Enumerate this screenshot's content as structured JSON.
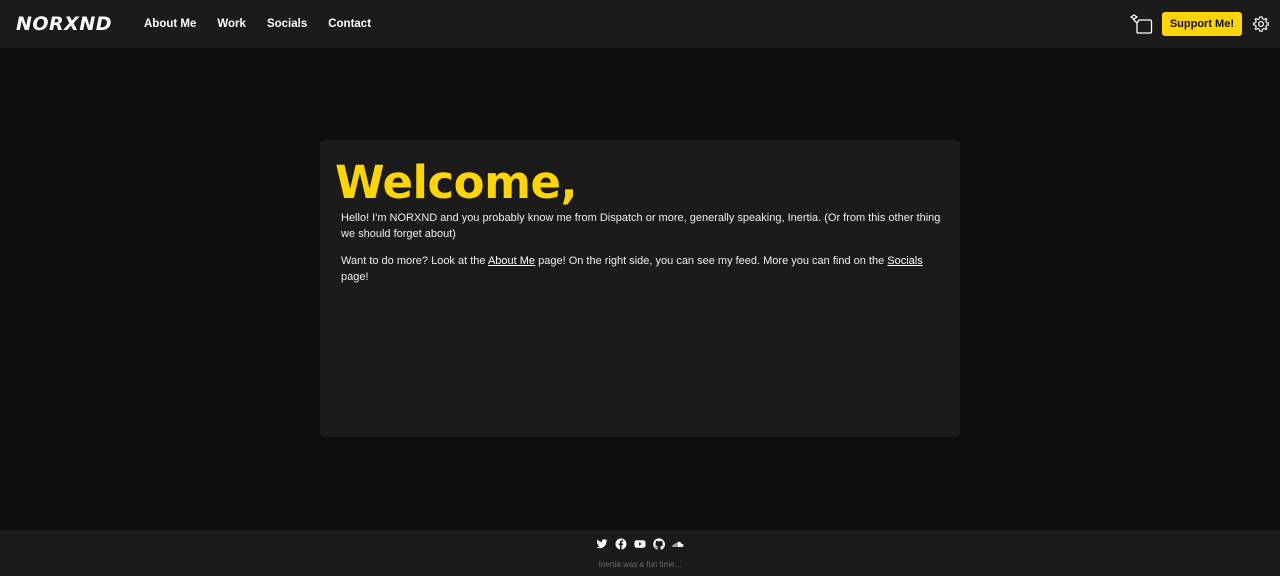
{
  "header": {
    "logo": "NORXND",
    "nav": [
      {
        "label": "About Me"
      },
      {
        "label": "Work"
      },
      {
        "label": "Socials"
      },
      {
        "label": "Contact"
      }
    ],
    "support_label": "Support Me!",
    "icons": [
      "theme-toggle-icon",
      "gear-icon"
    ]
  },
  "main": {
    "title": "Welcome,",
    "paragraph1": "Hello! I'm NORXND and you probably know me from Dispatch or more, generally speaking, Inertia. (Or from this other thing we should forget about)",
    "paragraph2": {
      "before": "Want to do more? Look at the ",
      "link1": "About Me",
      "middle": " page! On the right side, you can see my feed. More you can find on the ",
      "link2": "Socials",
      "after": " page!"
    }
  },
  "footer": {
    "icons": [
      "twitter-icon",
      "facebook-icon",
      "youtube-icon",
      "github-icon",
      "soundcloud-icon"
    ],
    "caption": "Inertia was a fun time..."
  },
  "colors": {
    "accent": "#ffd500",
    "background": "#0e0e0e",
    "surface": "#1b1b1b"
  }
}
